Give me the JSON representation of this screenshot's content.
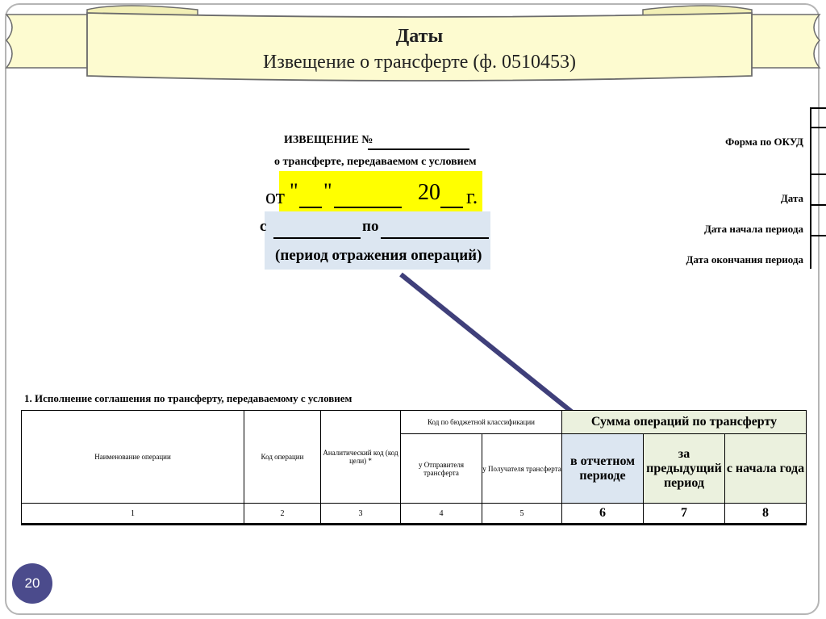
{
  "header": {
    "title": "Даты",
    "subtitle": "Извещение о трансферте (ф. 0510453)"
  },
  "form": {
    "notice_label": "ИЗВЕЩЕНИЕ №",
    "about_line": "о трансферте, передаваемом с условием",
    "date_from": "от",
    "date_quote1": "\"",
    "date_quote2": "\"",
    "year_prefix": "20",
    "year_suffix": "г.",
    "period_from": "с",
    "period_to": "по",
    "period_caption": "(период отражения операций)"
  },
  "right_labels": {
    "okud": "Форма по ОКУД",
    "date": "Дата",
    "period_start": "Дата начала периода",
    "period_end": "Дата окончания периода"
  },
  "table": {
    "title": "1. Исполнение соглашения по трансферту, передаваемому с условием",
    "col_operation_name": "Наименование операции",
    "col_operation_code": "Код операции",
    "col_analytic_code": "Аналитический код (код цели) *",
    "col_budget_class": "Код по бюджетной классификации",
    "col_sender": "у Отправителя трансферта",
    "col_receiver": "у Получателя трансферта",
    "col_sum": "Сумма операций по трансферту",
    "col_reporting": "в отчетном периоде",
    "col_previous": "за предыдущий период",
    "col_year_start": "с начала года",
    "numbers": [
      "1",
      "2",
      "3",
      "4",
      "5",
      "6",
      "7",
      "8"
    ]
  },
  "page_number": "20",
  "colors": {
    "scroll_fill": "#fdfbd0",
    "highlight_yellow": "#ffff00",
    "highlight_blue": "#dce6f1",
    "arrow": "#3f3f7a",
    "header_green": "#ebf1de",
    "badge": "#4b4b8c"
  }
}
